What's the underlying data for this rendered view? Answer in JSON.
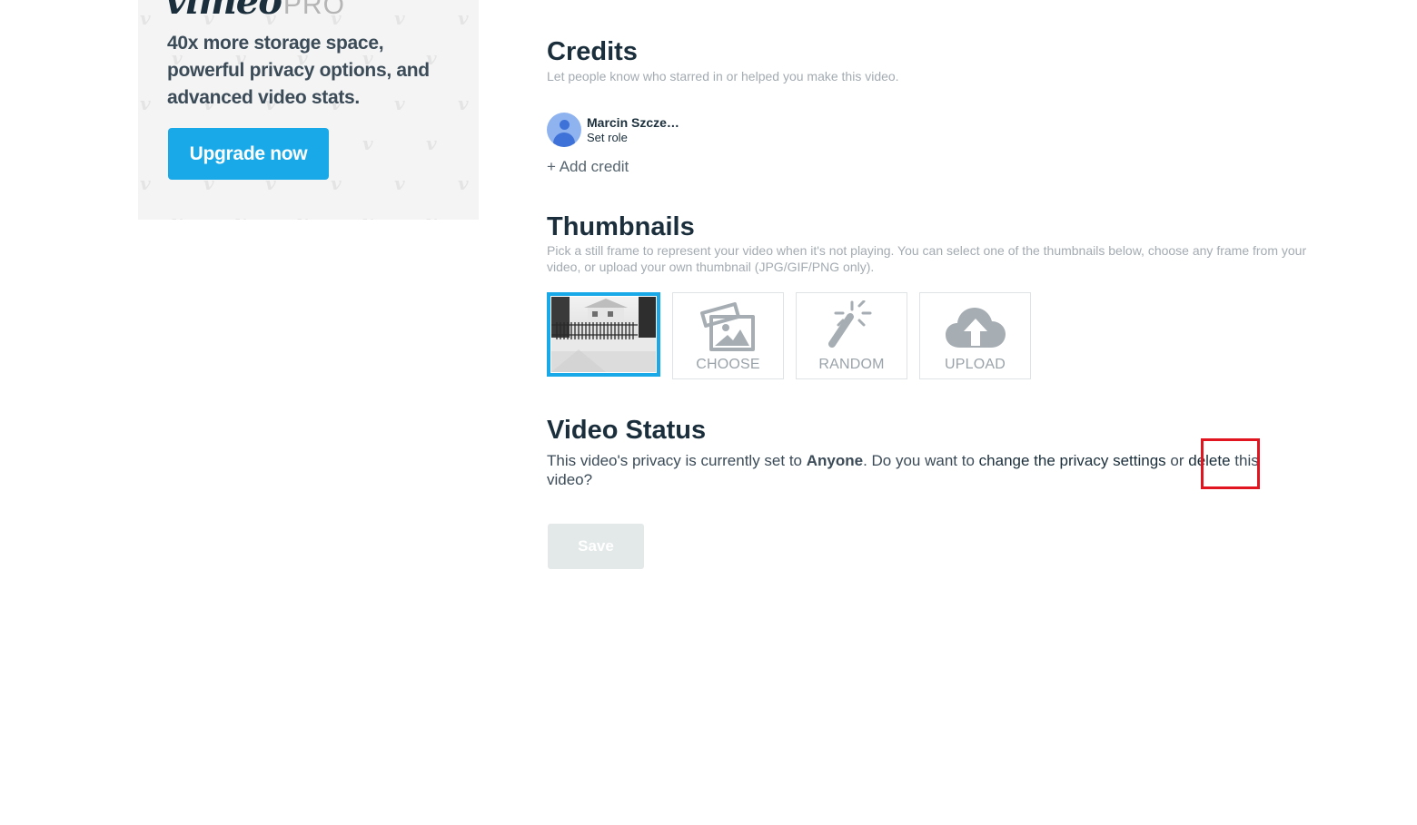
{
  "promo": {
    "logo_text": "vimeo",
    "logo_suffix": "PRO",
    "headline": "40x more storage space, powerful privacy options, and advanced video stats.",
    "cta_label": "Upgrade now",
    "accent_color": "#1aa9e8"
  },
  "credits": {
    "title": "Credits",
    "description": "Let people know who starred in or helped you make this video.",
    "items": [
      {
        "name": "Marcin Szcze…",
        "role_label": "Set role",
        "avatar_icon": "user-avatar-icon"
      }
    ],
    "add_label": "+ Add credit"
  },
  "thumbnails": {
    "title": "Thumbnails",
    "description": "Pick a still frame to represent your video when it's not playing. You can select one of the thumbnails below, choose any frame from your video, or upload your own thumbnail (JPG/GIF/PNG only).",
    "options": [
      {
        "type": "frame",
        "selected": true,
        "icon": "thumbnail-image"
      },
      {
        "label": "CHOOSE",
        "icon": "images-icon"
      },
      {
        "label": "RANDOM",
        "icon": "magic-wand-icon"
      },
      {
        "label": "UPLOAD",
        "icon": "cloud-upload-icon"
      }
    ]
  },
  "status": {
    "title": "Video Status",
    "text_before": "This video's privacy is currently set to ",
    "privacy_value": "Anyone",
    "text_middle": ". Do you want to ",
    "change_link": "change the privacy settings",
    "text_or": " or ",
    "delete_link": "delete",
    "text_after": " this video?"
  },
  "save_label": "Save",
  "colors": {
    "heading": "#1a2e3b",
    "muted": "#a3abb2",
    "highlight": "#e0151f",
    "save_disabled_bg": "#e3e8e9"
  }
}
